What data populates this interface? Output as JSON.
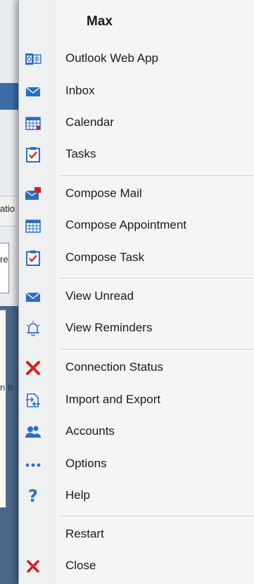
{
  "background": {
    "fragment_text_1": "atio",
    "fragment_text_2": "re",
    "fragment_text_3": "n It"
  },
  "menu": {
    "title": "Max",
    "groups": [
      {
        "items": [
          {
            "label": "Outlook Web App",
            "icon": "outlook-web-app-icon"
          },
          {
            "label": "Inbox",
            "icon": "inbox-envelope-icon"
          },
          {
            "label": "Calendar",
            "icon": "calendar-icon"
          },
          {
            "label": "Tasks",
            "icon": "tasks-checkbox-icon"
          }
        ]
      },
      {
        "items": [
          {
            "label": "Compose Mail",
            "icon": "compose-mail-icon"
          },
          {
            "label": "Compose Appointment",
            "icon": "compose-appointment-icon"
          },
          {
            "label": "Compose Task",
            "icon": "compose-task-icon"
          }
        ]
      },
      {
        "items": [
          {
            "label": "View Unread",
            "icon": "unread-envelope-icon"
          },
          {
            "label": "View Reminders",
            "icon": "reminder-bell-icon"
          }
        ]
      },
      {
        "items": [
          {
            "label": "Connection Status",
            "icon": "red-x-icon"
          },
          {
            "label": "Import and Export",
            "icon": "import-export-icon"
          },
          {
            "label": "Accounts",
            "icon": "accounts-people-icon"
          },
          {
            "label": "Options",
            "icon": "options-dots-icon"
          },
          {
            "label": "Help",
            "icon": "help-question-icon"
          }
        ]
      },
      {
        "items": [
          {
            "label": "Restart",
            "icon": ""
          },
          {
            "label": "Close",
            "icon": "close-x-icon"
          }
        ]
      }
    ]
  },
  "colors": {
    "accent_blue": "#2c6ec2",
    "red": "#d81e1e",
    "menu_bg": "#f5f5f5"
  }
}
